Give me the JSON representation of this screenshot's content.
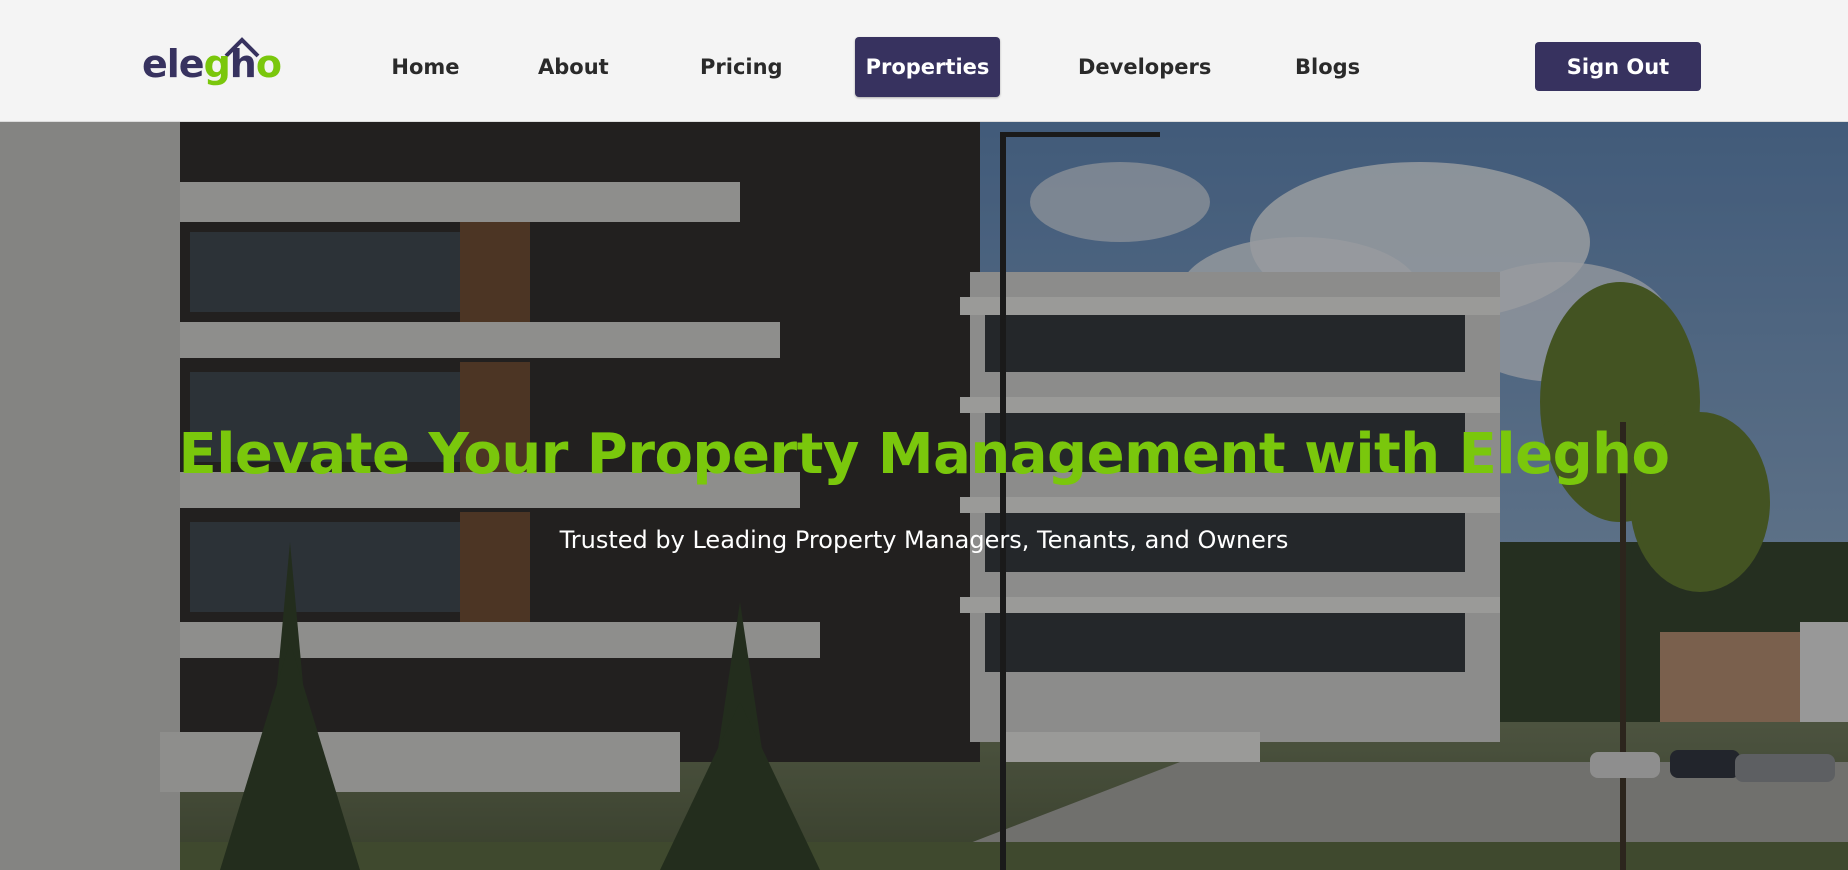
{
  "brand": {
    "logo_parts": {
      "a": "ele",
      "b": "g",
      "c": "h",
      "d": "o"
    },
    "primary_color": "#37325f",
    "accent_color": "#7ac70c"
  },
  "nav": {
    "items": [
      {
        "label": "Home",
        "active": false
      },
      {
        "label": "About",
        "active": false
      },
      {
        "label": "Pricing",
        "active": false
      },
      {
        "label": "Properties",
        "active": true
      },
      {
        "label": "Developers",
        "active": false
      },
      {
        "label": "Blogs",
        "active": false
      }
    ],
    "sign_out_label": "Sign Out"
  },
  "hero": {
    "title": "Elevate Your Property Management with Elegho",
    "subtitle": "Trusted by Leading Property Managers, Tenants, and Owners",
    "background_description_icon": "apartment-buildings-photo"
  }
}
